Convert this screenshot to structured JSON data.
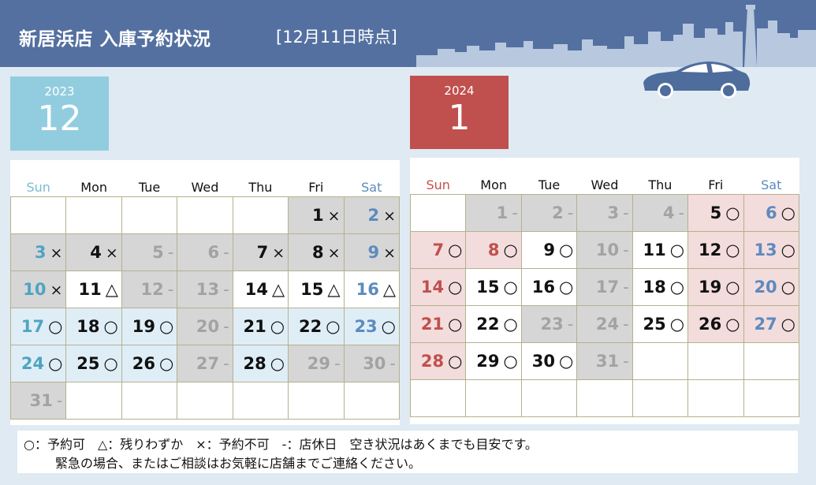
{
  "header": {
    "title": "新居浜店 入庫予約状況",
    "date_note": "[12月11日時点]"
  },
  "months": [
    {
      "year": "2023",
      "month": "12",
      "dow": [
        "Sun",
        "Mon",
        "Tue",
        "Wed",
        "Thu",
        "Fri",
        "Sat"
      ],
      "weeks": [
        [
          null,
          null,
          null,
          null,
          null,
          {
            "d": "1",
            "s": "×"
          },
          {
            "d": "2",
            "s": "×"
          }
        ],
        [
          {
            "d": "3",
            "s": "×"
          },
          {
            "d": "4",
            "s": "×"
          },
          {
            "d": "5",
            "s": "-"
          },
          {
            "d": "6",
            "s": "-"
          },
          {
            "d": "7",
            "s": "×"
          },
          {
            "d": "8",
            "s": "×"
          },
          {
            "d": "9",
            "s": "×"
          }
        ],
        [
          {
            "d": "10",
            "s": "×"
          },
          {
            "d": "11",
            "s": "△"
          },
          {
            "d": "12",
            "s": "-"
          },
          {
            "d": "13",
            "s": "-"
          },
          {
            "d": "14",
            "s": "△"
          },
          {
            "d": "15",
            "s": "△"
          },
          {
            "d": "16",
            "s": "△"
          }
        ],
        [
          {
            "d": "17",
            "s": "○"
          },
          {
            "d": "18",
            "s": "○"
          },
          {
            "d": "19",
            "s": "○"
          },
          {
            "d": "20",
            "s": "-"
          },
          {
            "d": "21",
            "s": "○"
          },
          {
            "d": "22",
            "s": "○"
          },
          {
            "d": "23",
            "s": "○"
          }
        ],
        [
          {
            "d": "24",
            "s": "○"
          },
          {
            "d": "25",
            "s": "○"
          },
          {
            "d": "26",
            "s": "○"
          },
          {
            "d": "27",
            "s": "-"
          },
          {
            "d": "28",
            "s": "○"
          },
          {
            "d": "29",
            "s": "-"
          },
          {
            "d": "30",
            "s": "-"
          }
        ],
        [
          {
            "d": "31",
            "s": "-"
          },
          null,
          null,
          null,
          null,
          null,
          null
        ]
      ]
    },
    {
      "year": "2024",
      "month": "1",
      "dow": [
        "Sun",
        "Mon",
        "Tue",
        "Wed",
        "Thu",
        "Fri",
        "Sat"
      ],
      "weeks": [
        [
          null,
          {
            "d": "1",
            "s": "-"
          },
          {
            "d": "2",
            "s": "-"
          },
          {
            "d": "3",
            "s": "-"
          },
          {
            "d": "4",
            "s": "-"
          },
          {
            "d": "5",
            "s": "○"
          },
          {
            "d": "6",
            "s": "○"
          }
        ],
        [
          {
            "d": "7",
            "s": "○"
          },
          {
            "d": "8",
            "s": "○"
          },
          {
            "d": "9",
            "s": "○"
          },
          {
            "d": "10",
            "s": "-"
          },
          {
            "d": "11",
            "s": "○"
          },
          {
            "d": "12",
            "s": "○"
          },
          {
            "d": "13",
            "s": "○"
          }
        ],
        [
          {
            "d": "14",
            "s": "○"
          },
          {
            "d": "15",
            "s": "○"
          },
          {
            "d": "16",
            "s": "○"
          },
          {
            "d": "17",
            "s": "-"
          },
          {
            "d": "18",
            "s": "○"
          },
          {
            "d": "19",
            "s": "○"
          },
          {
            "d": "20",
            "s": "○"
          }
        ],
        [
          {
            "d": "21",
            "s": "○"
          },
          {
            "d": "22",
            "s": "○"
          },
          {
            "d": "23",
            "s": "-"
          },
          {
            "d": "24",
            "s": "-"
          },
          {
            "d": "25",
            "s": "○"
          },
          {
            "d": "26",
            "s": "○"
          },
          {
            "d": "27",
            "s": "○"
          }
        ],
        [
          {
            "d": "28",
            "s": "○"
          },
          {
            "d": "29",
            "s": "○"
          },
          {
            "d": "30",
            "s": "○"
          },
          {
            "d": "31",
            "s": "-"
          },
          null,
          null,
          null
        ],
        [
          null,
          null,
          null,
          null,
          null,
          null,
          null
        ]
      ]
    }
  ],
  "legend": {
    "line1": "○：予約可　△：残りわずか　×：予約不可　-：店休日　空き状況はあくまでも目安です。",
    "line2": "緊急の場合、またはご相談はお気軽に店舗までご連絡ください。"
  },
  "colors": {
    "header_bg": "#5470a0",
    "page_bg": "#dfeaf3",
    "dec_badge": "#92cddf",
    "jan_badge": "#c0504d",
    "holiday_gray": "#d6d6d6",
    "available_blue": "#dfeef6",
    "available_pink": "#f3dcdc",
    "sunday_dec": "#4ea4c1",
    "sunday_jan": "#c0504d",
    "saturday": "#5d8abe"
  },
  "icons": {
    "skyline": "city-skyline-icon",
    "car": "car-icon"
  }
}
